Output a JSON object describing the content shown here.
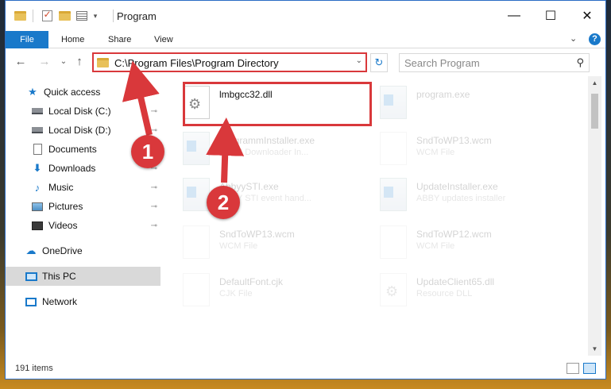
{
  "window": {
    "title": "Program",
    "minimize": "—",
    "maximize": "☐",
    "close": "✕"
  },
  "ribbon": {
    "tabs": [
      "File",
      "Home",
      "Share",
      "View"
    ],
    "expand": "⌄",
    "help": "?"
  },
  "nav": {
    "back": "←",
    "forward": "→",
    "recent": "⌄",
    "up": "↑",
    "address": "C:\\Program Files\\Program Directory",
    "address_dropdown": "⌄",
    "refresh": "↻",
    "search_placeholder": "Search Program",
    "search_icon": "⚲"
  },
  "sidebar": {
    "items": [
      {
        "label": "Quick access",
        "icon": "star-icon"
      },
      {
        "label": "Local Disk (C:)",
        "icon": "drive-icon",
        "pinned": true
      },
      {
        "label": "Local Disk (D:)",
        "icon": "drive-icon",
        "pinned": true
      },
      {
        "label": "Documents",
        "icon": "documents-icon",
        "pinned": true
      },
      {
        "label": "Downloads",
        "icon": "downloads-icon",
        "pinned": true
      },
      {
        "label": "Music",
        "icon": "music-icon",
        "pinned": true
      },
      {
        "label": "Pictures",
        "icon": "pictures-icon",
        "pinned": true
      },
      {
        "label": "Videos",
        "icon": "videos-icon",
        "pinned": true
      },
      {
        "label": "OneDrive",
        "icon": "onedrive-icon"
      },
      {
        "label": "This PC",
        "icon": "this-pc-icon",
        "selected": true
      },
      {
        "label": "Network",
        "icon": "network-icon"
      }
    ],
    "pin_glyph": "📌"
  },
  "files": [
    {
      "name": "lmbgcc32.dll",
      "desc": "",
      "type": "dll",
      "highlighted": true
    },
    {
      "name": "program.exe",
      "desc": "",
      "type": "exe"
    },
    {
      "name": "ProgrammInstaller.exe",
      "desc": "ABBY Downloader In...",
      "type": "exe"
    },
    {
      "name": "SndToWP13.wcm",
      "desc": "WCM File",
      "type": "doc"
    },
    {
      "name": "AbbyySTI.exe",
      "desc": "ABBY STI event hand...",
      "type": "exe"
    },
    {
      "name": "UpdateInstaller.exe",
      "desc": "ABBY updates installer",
      "type": "exe"
    },
    {
      "name": "SndToWP13.wcm",
      "desc": "WCM File",
      "type": "doc"
    },
    {
      "name": "SndToWP12.wcm",
      "desc": "WCM File",
      "type": "doc"
    },
    {
      "name": "DefaultFont.cjk",
      "desc": "CJK File",
      "type": "doc"
    },
    {
      "name": "UpdateClient65.dll",
      "desc": "Resource DLL",
      "type": "dll"
    }
  ],
  "status": {
    "item_count": "191 items"
  },
  "annotations": {
    "step1": "1",
    "step2": "2",
    "color": "#d9383b"
  },
  "colors": {
    "accent": "#1979ca",
    "highlight": "#d9383b"
  }
}
